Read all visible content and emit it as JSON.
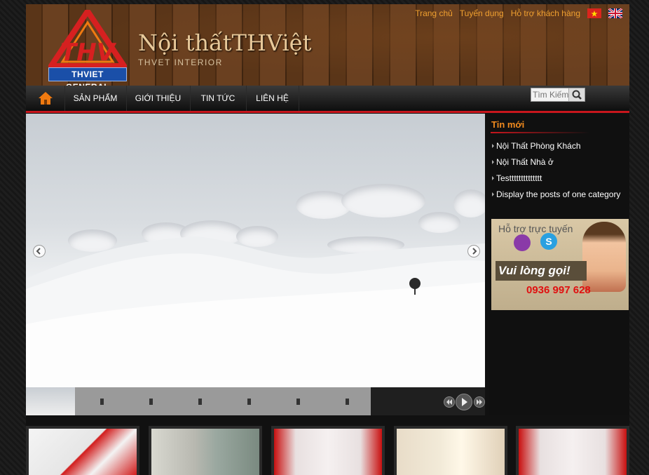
{
  "header": {
    "logo_badge": "THVIET GENERAL",
    "brand_title": "Nội thấtTHViệt",
    "brand_subtitle": "THVET INTERIOR",
    "top_links": [
      "Trang chủ",
      "Tuyển dụng",
      "Hỗ trợ khách hàng"
    ],
    "flags": [
      "vietnam-flag-icon",
      "uk-flag-icon"
    ]
  },
  "nav": {
    "home_icon": "home-icon",
    "items": [
      "SẢN PHẨM",
      "GIỚI THIỆU",
      "TIN TỨC",
      "LIÊN HỆ"
    ],
    "search_placeholder": "Tìm Kiếm"
  },
  "sidebar": {
    "title": "Tin mới",
    "news": [
      "Nội Thất Phòng Khách",
      "Nội Thất Nhà ở",
      "Testttttttttttttt",
      "Display the posts of one category"
    ],
    "support": {
      "title": "Hỗ trợ trực tuyến",
      "call_text": "Vui lòng gọi!",
      "phone": "0936 997 628"
    }
  },
  "colors": {
    "accent_red": "#c8161d",
    "link_orange": "#f0a030",
    "nav_bg": "#1a1a1a"
  }
}
